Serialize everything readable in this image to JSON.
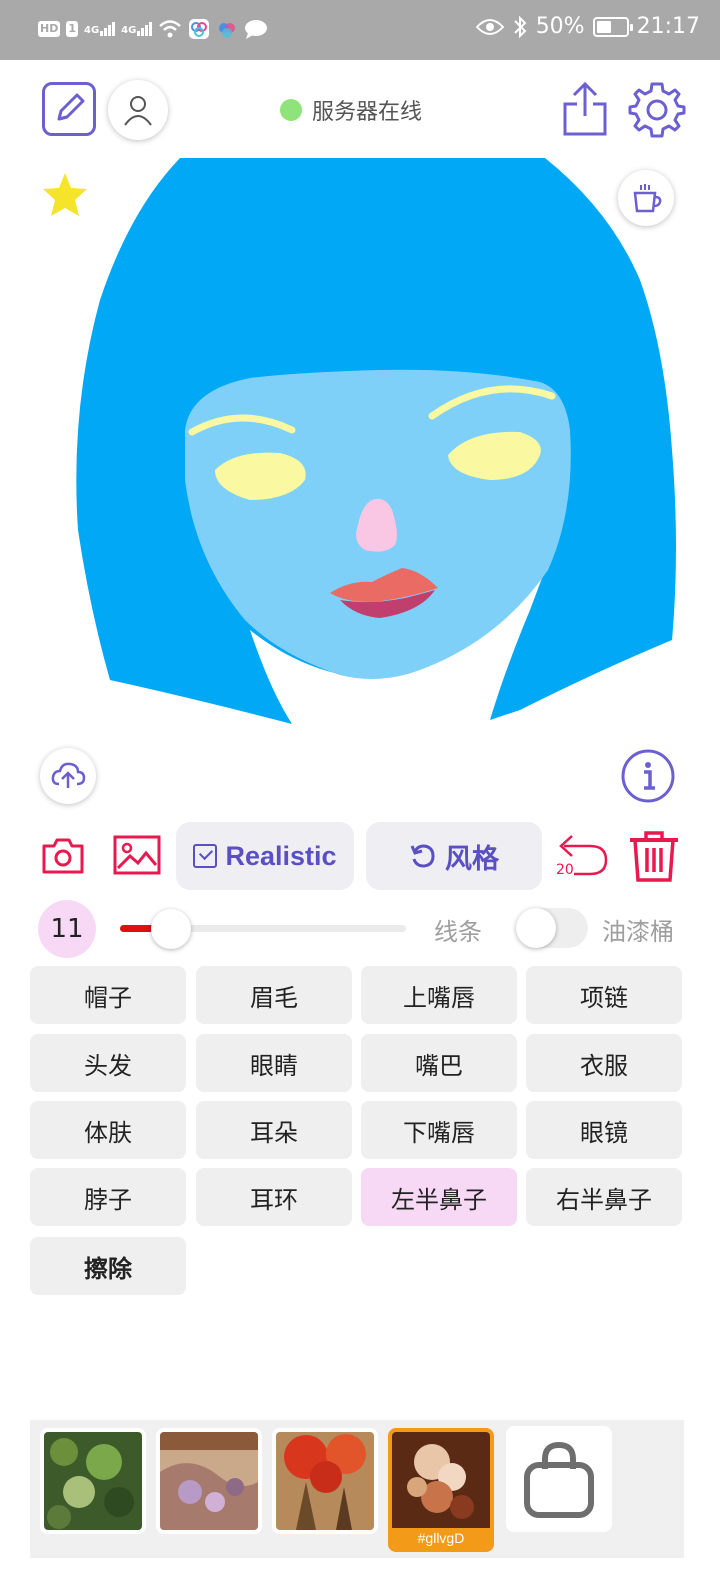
{
  "status_bar": {
    "hd": "HD",
    "sim": "1",
    "net1": "4G",
    "net2": "4G",
    "battery_percent": "50%",
    "battery_level": 0.5,
    "time": "21:17"
  },
  "header": {
    "server_status": "服务器在线",
    "server_status_color": "#8ee37a"
  },
  "canvas": {
    "hair_color": "#00a8f5",
    "skin_color": "#7fd0f9",
    "eye_color": "#faf8a0",
    "nose_color": "#f9c7e4",
    "lip_upper_color": "#ea6b63",
    "lip_lower_color": "#c03f6d"
  },
  "toolbar": {
    "realistic_label": "Realistic",
    "realistic_checked": true,
    "style_label": "风格",
    "undo_count": "20",
    "accent_color": "#5b4fc4",
    "icon_red": "#e8194f"
  },
  "brush": {
    "size": "11",
    "size_fraction": 0.18,
    "line_label": "线条",
    "bucket_label": "油漆桶",
    "bucket_enabled": false
  },
  "parts": [
    {
      "label": "帽子",
      "selected": false
    },
    {
      "label": "眉毛",
      "selected": false
    },
    {
      "label": "上嘴唇",
      "selected": false
    },
    {
      "label": "项链",
      "selected": false
    },
    {
      "label": "头发",
      "selected": false
    },
    {
      "label": "眼睛",
      "selected": false
    },
    {
      "label": "嘴巴",
      "selected": false
    },
    {
      "label": "衣服",
      "selected": false
    },
    {
      "label": "体肤",
      "selected": false
    },
    {
      "label": "耳朵",
      "selected": false
    },
    {
      "label": "下嘴唇",
      "selected": false
    },
    {
      "label": "眼镜",
      "selected": false
    },
    {
      "label": "脖子",
      "selected": false
    },
    {
      "label": "耳环",
      "selected": false
    },
    {
      "label": "左半鼻子",
      "selected": true
    },
    {
      "label": "右半鼻子",
      "selected": false
    },
    {
      "label": "擦除",
      "selected": false,
      "bold": true
    }
  ],
  "styles": {
    "active_label": "#gllvgD",
    "active_color": "#f39a18",
    "shop_icon": "bag-icon"
  }
}
